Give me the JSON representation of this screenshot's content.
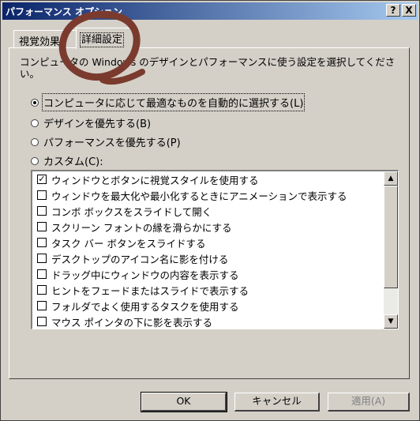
{
  "window": {
    "title": "パフォーマンス オプション",
    "help_btn": "?",
    "close_btn": "X"
  },
  "tabs": [
    {
      "label": "視覚効果"
    },
    {
      "label": "詳細設定"
    }
  ],
  "description": "コンピュータの Windows のデザインとパフォーマンスに使う設定を選択してください。",
  "radios": [
    {
      "label": "コンピュータに応じて最適なものを自動的に選択する(L)",
      "selected": true
    },
    {
      "label": "デザインを優先する(B)",
      "selected": false
    },
    {
      "label": "パフォーマンスを優先する(P)",
      "selected": false
    },
    {
      "label": "カスタム(C):",
      "selected": false
    }
  ],
  "effects": [
    {
      "label": "ウィンドウとボタンに視覚スタイルを使用する",
      "checked": true
    },
    {
      "label": "ウィンドウを最大化や最小化するときにアニメーションで表示する",
      "checked": false
    },
    {
      "label": "コンボ ボックスをスライドして開く",
      "checked": false
    },
    {
      "label": "スクリーン フォントの縁を滑らかにする",
      "checked": false
    },
    {
      "label": "タスク バー ボタンをスライドする",
      "checked": false
    },
    {
      "label": "デスクトップのアイコン名に影を付ける",
      "checked": false
    },
    {
      "label": "ドラッグ中にウィンドウの内容を表示する",
      "checked": false
    },
    {
      "label": "ヒントをフェードまたはスライドで表示する",
      "checked": false
    },
    {
      "label": "フォルダでよく使用するタスクを使用する",
      "checked": false
    },
    {
      "label": "マウス ポインタの下に影を表示する",
      "checked": false
    }
  ],
  "buttons": {
    "ok": "OK",
    "cancel": "キャンセル",
    "apply": "適用(A)"
  },
  "colors": {
    "annotation": "#7a3b2e",
    "titlebar": "#0a246a",
    "face": "#d4d0c8"
  }
}
